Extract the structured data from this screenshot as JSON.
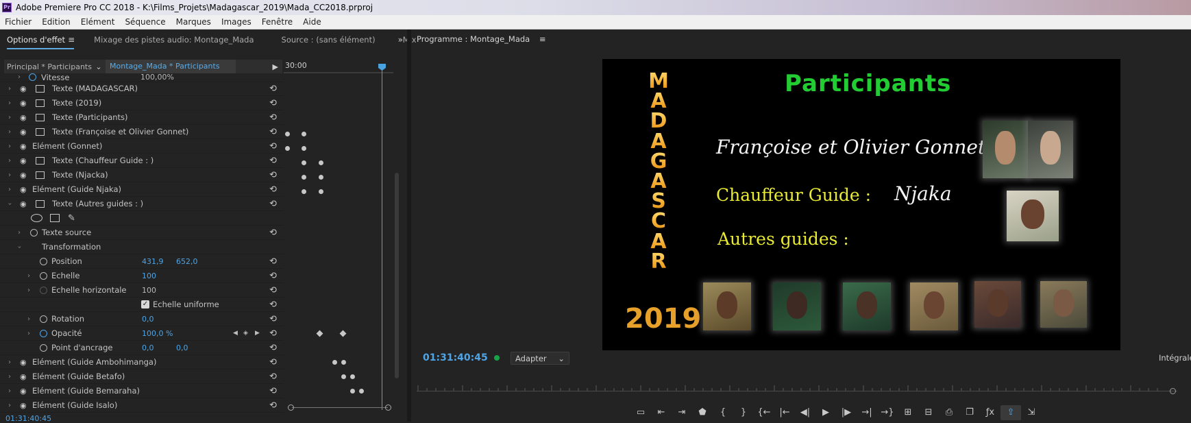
{
  "window": {
    "title": "Adobe Premiere Pro CC 2018 - K:\\Films_Projets\\Madagascar_2019\\Mada_CC2018.prproj",
    "app_icon": "Pr"
  },
  "menu": [
    "Fichier",
    "Edition",
    "Elément",
    "Séquence",
    "Marques",
    "Images",
    "Fenêtre",
    "Aide"
  ],
  "left_tabs": {
    "effect_options": "Options d'effet",
    "audio_mixer": "Mixage des pistes audio: Montage_Mada",
    "source": "Source : (sans élément)",
    "truncated": "Mix",
    "more": "»"
  },
  "effect_controls": {
    "master": "Principal * Participants",
    "clip": "Montage_Mada * Participants",
    "timecode": "30:00",
    "top_partial": {
      "label": "Vitesse",
      "value": "100,00%"
    },
    "rows": [
      {
        "label": "Texte (MADAGASCAR)",
        "kind": "text"
      },
      {
        "label": "Texte (2019)",
        "kind": "text"
      },
      {
        "label": "Texte (Participants)",
        "kind": "text"
      },
      {
        "label": "Texte (Françoise et Olivier Gonnet)",
        "kind": "text"
      },
      {
        "label": "Elément (Gonnet)",
        "kind": "element"
      },
      {
        "label": "Texte (Chauffeur Guide  : )",
        "kind": "text"
      },
      {
        "label": "Texte (Njacka)",
        "kind": "text"
      },
      {
        "label": "Elément (Guide Njaka)",
        "kind": "element"
      },
      {
        "label": "Texte (Autres guides : )",
        "kind": "text"
      }
    ],
    "source_text": "Texte source",
    "transformation": "Transformation",
    "position": {
      "label": "Position",
      "x": "431,9",
      "y": "652,0"
    },
    "scale": {
      "label": "Echelle",
      "value": "100"
    },
    "scale_h": {
      "label": "Echelle horizontale",
      "value": "100"
    },
    "uniform": {
      "label": "Echelle uniforme",
      "checked": true
    },
    "rotation": {
      "label": "Rotation",
      "value": "0,0"
    },
    "opacity": {
      "label": "Opacité",
      "value": "100,0 %"
    },
    "anchor": {
      "label": "Point d'ancrage",
      "x": "0,0",
      "y": "0,0"
    },
    "more_rows": [
      "Elément (Guide Ambohimanga)",
      "Elément (Guide Betafo)",
      "Elément (Guide Bemaraha)",
      "Elément (Guide Isalo)"
    ],
    "bottom_timecode": "01:31:40:45"
  },
  "program": {
    "tab": "Programme : Montage_Mada",
    "timecode": "01:31:40:45",
    "fit": "Adapter",
    "full": "Intégrale",
    "frame": {
      "madagascar": [
        "M",
        "A",
        "D",
        "A",
        "G",
        "A",
        "S",
        "C",
        "A",
        "R"
      ],
      "year": "2019",
      "title": "Participants",
      "names": "Françoise et Olivier Gonnet",
      "driver_label": "Chauffeur Guide  :",
      "driver_name": "Njaka",
      "others": "Autres guides :"
    }
  },
  "colors": {
    "accent": "#4fa4e6",
    "title_green": "#22cc33",
    "gold": "#e7a12a",
    "yellow": "#e8ea33"
  }
}
